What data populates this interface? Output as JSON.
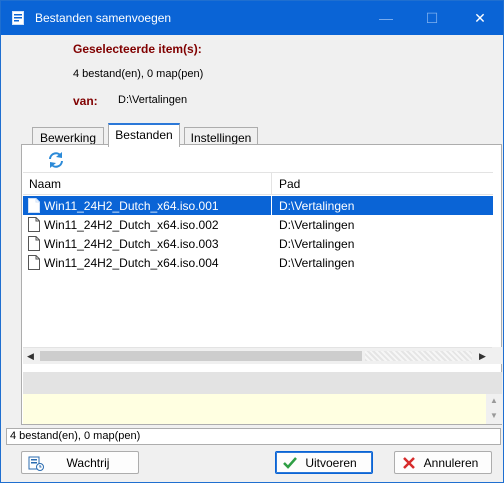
{
  "window": {
    "title": "Bestanden samenvoegen",
    "minimize_glyph": "—",
    "maximize_glyph": "☐",
    "close_glyph": "✕"
  },
  "info": {
    "selected_label": "Geselecteerde item(s):",
    "selected_count": "4 bestand(en), 0 map(pen)",
    "from_label": "van:",
    "from_path": "D:\\Vertalingen"
  },
  "tabs": [
    {
      "label": "Bewerking",
      "active": false
    },
    {
      "label": "Bestanden",
      "active": true
    },
    {
      "label": "Instellingen",
      "active": false
    }
  ],
  "toolbar": {
    "refresh_icon": "refresh-icon"
  },
  "list": {
    "columns": [
      "Naam",
      "Pad"
    ],
    "rows": [
      {
        "name": "Win11_24H2_Dutch_x64.iso.001",
        "path": "D:\\Vertalingen",
        "selected": true
      },
      {
        "name": "Win11_24H2_Dutch_x64.iso.002",
        "path": "D:\\Vertalingen",
        "selected": false
      },
      {
        "name": "Win11_24H2_Dutch_x64.iso.003",
        "path": "D:\\Vertalingen",
        "selected": false
      },
      {
        "name": "Win11_24H2_Dutch_x64.iso.004",
        "path": "D:\\Vertalingen",
        "selected": false
      }
    ]
  },
  "statusbar": {
    "text": "4 bestand(en), 0 map(pen)"
  },
  "buttons": {
    "queue": "Wachtrij",
    "run": "Uitvoeren",
    "cancel": "Annuleren"
  },
  "colors": {
    "accent": "#0a64d6",
    "label_red": "#800000",
    "note_bg": "#ffffe1",
    "check_green": "#2e9e44",
    "cancel_red": "#d62b2b"
  }
}
